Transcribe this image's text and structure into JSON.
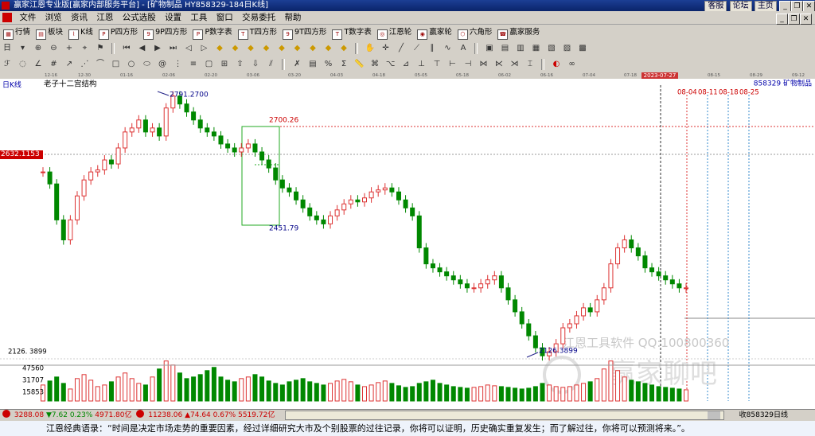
{
  "window": {
    "title": "赢家江恩专业版[赢家内部服务平台] - [矿物制品  HY858329-184日K线]",
    "title_links": [
      "客服",
      "论坛",
      "主页"
    ]
  },
  "menu": [
    "文件",
    "浏览",
    "资讯",
    "江恩",
    "公式选股",
    "设置",
    "工具",
    "窗口",
    "交易委托",
    "帮助"
  ],
  "toolbar1": [
    "行情",
    "板块",
    "K线",
    "P四方形",
    "9P四方形",
    "P数字表",
    "T四方形",
    "9T四方形",
    "T数字表",
    "江恩轮",
    "赢家轮",
    "六角形",
    "赢家服务"
  ],
  "toolbar1_icons": [
    "quote-table-icon",
    "sector-icon",
    "kline-icon",
    "p-square-icon",
    "9p-square-icon",
    "p-number-table-icon",
    "t-square-icon",
    "9t-square-icon",
    "t-number-table-icon",
    "gann-wheel-icon",
    "winner-wheel-icon",
    "hexagon-icon",
    "service-icon"
  ],
  "period_selector": "日",
  "date_axis": [
    "12-16",
    "12-30",
    "01-16",
    "02-06",
    "02-20",
    "03-06",
    "03-20",
    "04-03",
    "04-18",
    "05-05",
    "05-18",
    "06-02",
    "06-16",
    "07-04",
    "07-18",
    "08-15",
    "08-29",
    "09-12"
  ],
  "cursor_date": "2023-07-27",
  "chart": {
    "period_label": "日K线",
    "study_name": "老子十二宫结构",
    "code_title": "858329  矿物制品",
    "price_marker": "2632.1153",
    "labels": {
      "high": "2791.2700",
      "box_high": "2700.26",
      "box_low": "2451.79",
      "low": "2126.3899",
      "axis_low": "2126. 3899"
    },
    "future_dates": [
      "08-04",
      "08-11",
      "08-18",
      "08-25"
    ],
    "volume_axis": [
      "47560",
      "31707",
      "15853"
    ],
    "watermark": [
      "江恩工具软件  QQ:100800360",
      "赢家聊吧"
    ]
  },
  "chart_data": {
    "type": "candlestick",
    "title": "老子十二宫结构",
    "high_label": 2791.27,
    "low_label": 2126.3899,
    "box": {
      "high": 2700.26,
      "low": 2451.79
    },
    "close_series": [
      2590,
      2560,
      2470,
      2420,
      2470,
      2530,
      2570,
      2590,
      2595,
      2620,
      2610,
      2650,
      2690,
      2700,
      2720,
      2690,
      2700,
      2680,
      2750,
      2780,
      2760,
      2740,
      2720,
      2700,
      2690,
      2680,
      2660,
      2650,
      2640,
      2650,
      2660,
      2640,
      2620,
      2600,
      2570,
      2550,
      2540,
      2520,
      2500,
      2480,
      2470,
      2460,
      2480,
      2495,
      2510,
      2520,
      2515,
      2525,
      2540,
      2545,
      2550,
      2540,
      2520,
      2500,
      2480,
      2400,
      2360,
      2350,
      2340,
      2330,
      2320,
      2310,
      2300,
      2300,
      2310,
      2320,
      2330,
      2300,
      2270,
      2240,
      2210,
      2180,
      2150,
      2130,
      2140,
      2160,
      2200,
      2210,
      2230,
      2250,
      2240,
      2270,
      2300,
      2360,
      2400,
      2420,
      2400,
      2380,
      2350,
      2340,
      2330,
      2320,
      2310,
      2300,
      2300
    ],
    "volume_series": [
      20000,
      25000,
      30000,
      22000,
      15000,
      28000,
      33000,
      26000,
      18000,
      20000,
      24000,
      30000,
      35000,
      28000,
      22000,
      20000,
      30000,
      40000,
      50000,
      45000,
      35000,
      28000,
      30000,
      33000,
      38000,
      42000,
      30000,
      26000,
      24000,
      28000,
      30000,
      33000,
      30000,
      25000,
      22000,
      20000,
      24000,
      26000,
      28000,
      24000,
      22000,
      20000,
      22000,
      25000,
      27000,
      24000,
      20000,
      18000,
      20000,
      23000,
      25000,
      22000,
      19000,
      17000,
      18000,
      22000,
      24000,
      26000,
      22000,
      20000,
      18000,
      17000,
      16000,
      17000,
      18000,
      20000,
      19000,
      18000,
      17000,
      16000,
      15000,
      16000,
      18000,
      22000,
      20000,
      18000,
      17000,
      18000,
      20000,
      22000,
      24000,
      28000,
      40000,
      50000,
      38000,
      30000,
      26000,
      24000,
      22000,
      20000,
      18000,
      17000,
      16000,
      15000,
      14000
    ],
    "volume_axis": [
      47560,
      31707,
      15853
    ],
    "cursor_date": "2023-07-27",
    "future_marks": [
      "08-04",
      "08-11",
      "08-18",
      "08-25"
    ]
  },
  "status": {
    "sh_index": "3288.08",
    "sh_change": "▼7.62",
    "sh_pct": "0.23%",
    "sh_amount": "4971.80亿",
    "sz_index": "11238.06",
    "sz_change": "▲74.64",
    "sz_pct": "0.67%",
    "sz_amount": "5519.72亿",
    "right_text": "收858329日线"
  },
  "quote": "江恩经典语录：“时间是决定市场走势的重要因素，经过详细研究大市及个别股票的过往记录，你将可以证明，历史确实重复发生；而了解过往，你将可以预测将来。”。"
}
